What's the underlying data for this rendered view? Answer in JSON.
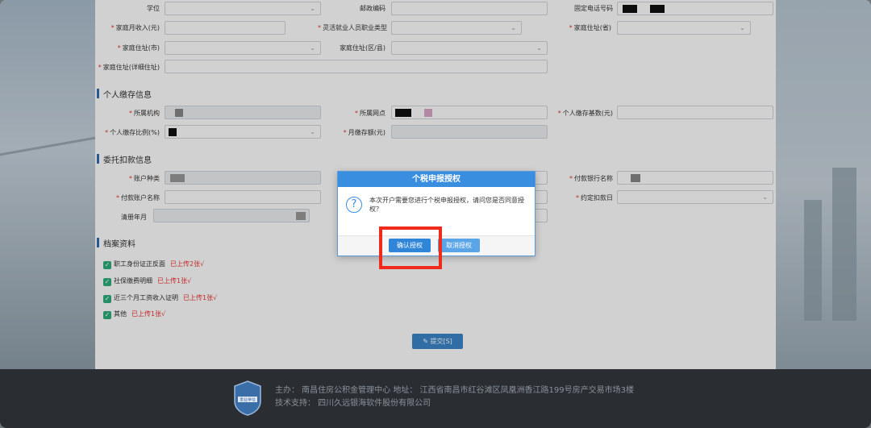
{
  "form": {
    "education_label": "学位",
    "postal_label": "邮政编码",
    "phone_label": "固定电话号码",
    "monthly_income_label": "家庭月收入(元)",
    "flex_job_label": "灵活就业人员职业类型",
    "province_label": "家庭住址(省)",
    "city_label": "家庭住址(市)",
    "district_label": "家庭住址(区/县)",
    "address_label": "家庭住址(详细住址)"
  },
  "deposit": {
    "section_title": "个人缴存信息",
    "org_label": "所属机构",
    "branch_label": "所属网点",
    "base_label": "个人缴存基数(元)",
    "ratio_label": "个人缴存比例(%)",
    "monthly_label": "月缴存额(元)"
  },
  "deduction": {
    "section_title": "委托扣款信息",
    "account_type_label": "账户种类",
    "bank_label": "付款银行名称",
    "account_name_label": "付款账户名称",
    "deduct_day_label": "约定扣款日",
    "settle_label": "清册年月"
  },
  "archive": {
    "section_title": "档案资料",
    "items": [
      {
        "label": "职工身份证正反面",
        "status": "已上传2张√"
      },
      {
        "label": "社保缴费明细",
        "status": "已上传1张√"
      },
      {
        "label": "近三个月工资收入证明",
        "status": "已上传1张√"
      },
      {
        "label": "其他",
        "status": "已上传1张√"
      }
    ]
  },
  "submit_label": "提交[S]",
  "dialog": {
    "title": "个税申报授权",
    "message": "本次开户需要您进行个税申报授权，请问您是否同意授权？",
    "confirm_label": "确认授权",
    "cancel_label": "取消授权"
  },
  "footer": {
    "host": "主办： 南昌住房公积金管理中心    地址：  江西省南昌市红谷滩区凤凰洲香江路199号房产交易市场3楼",
    "support": "技术支持：  四川久远银海软件股份有限公司",
    "logo_text": "事业单位"
  },
  "colors": {
    "accent": "#3a8ee0",
    "required": "#e33333",
    "highlight": "#f02b1b",
    "check": "#2fae7c"
  },
  "icons": {
    "dialog": "question-icon",
    "check": "check-icon",
    "submit": "edit-icon"
  }
}
